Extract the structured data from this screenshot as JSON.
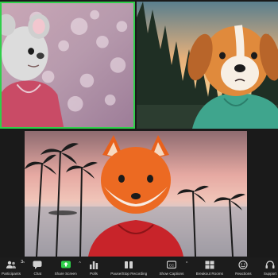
{
  "participants": [
    {
      "avatar": "koala-avatar",
      "background": "pink-bokeh",
      "active_speaker": true
    },
    {
      "avatar": "dog-avatar",
      "background": "forest-sunset",
      "active_speaker": false
    },
    {
      "avatar": "fox-avatar",
      "background": "tropical-sunset-beach",
      "active_speaker": false
    }
  ],
  "toolbar": {
    "participants": {
      "label": "Participants",
      "count": "3",
      "icon": "participants-icon"
    },
    "chat": {
      "label": "Chat",
      "icon": "chat-icon"
    },
    "share_screen": {
      "label": "Share Screen",
      "icon": "share-screen-icon"
    },
    "polls": {
      "label": "Polls",
      "icon": "polls-icon"
    },
    "recording": {
      "label": "Pause/Stop Recording",
      "icon": "recording-icon"
    },
    "captions": {
      "label": "Show Captions",
      "icon": "captions-icon"
    },
    "breakout": {
      "label": "Breakout Rooms",
      "icon": "breakout-rooms-icon"
    },
    "reactions": {
      "label": "Reactions",
      "icon": "reactions-icon"
    },
    "support": {
      "label": "Support",
      "icon": "support-icon"
    }
  },
  "colors": {
    "active_speaker_border": "#2fcf4a",
    "share_screen_accent": "#2fcf4a",
    "toolbar_bg": "#1c1c1c"
  }
}
